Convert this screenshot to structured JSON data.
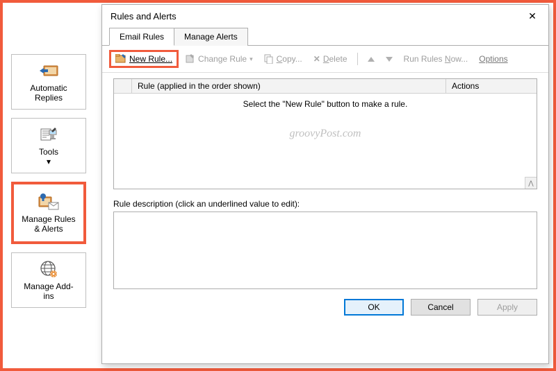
{
  "sidebar": {
    "items": [
      {
        "label": "Automatic\nReplies"
      },
      {
        "label": "Tools\n▾"
      },
      {
        "label": "Manage Rules\n& Alerts"
      },
      {
        "label": "Manage Add-\nins"
      }
    ]
  },
  "dialog": {
    "title": "Rules and Alerts",
    "tabs": [
      {
        "label": "Email Rules"
      },
      {
        "label": "Manage Alerts"
      }
    ],
    "toolbar": {
      "new_rule": "New Rule...",
      "change_rule": "Change Rule",
      "copy": "Copy...",
      "delete": "Delete",
      "run_rules": "Run Rules Now...",
      "options": "Options"
    },
    "list": {
      "checkbox_col": "",
      "rule_col": "Rule (applied in the order shown)",
      "actions_col": "Actions",
      "empty_text": "Select the \"New Rule\" button to make a rule."
    },
    "desc_label": "Rule description (click an underlined value to edit):",
    "buttons": {
      "ok": "OK",
      "cancel": "Cancel",
      "apply": "Apply"
    }
  },
  "watermark": "groovyPost.com"
}
